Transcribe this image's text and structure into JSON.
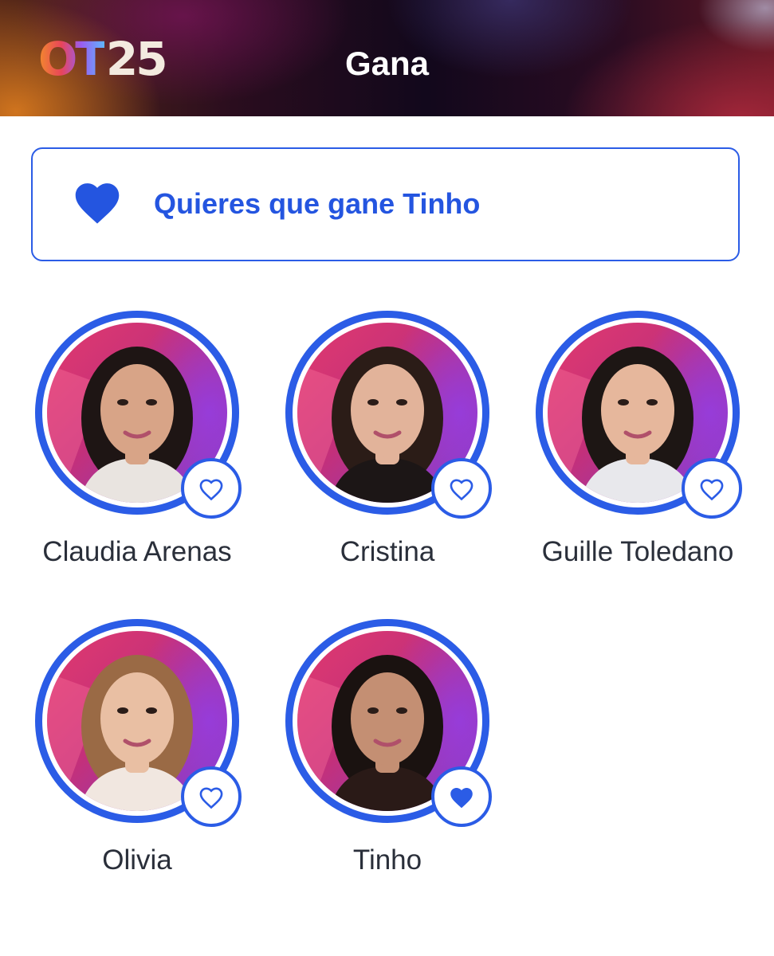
{
  "header": {
    "logo_text_ot": "OT",
    "logo_text_num": "25",
    "title": "Gana"
  },
  "vote_banner": {
    "text": "Quieres que gane Tinho",
    "icon": "heart-filled-icon"
  },
  "contestants": [
    {
      "name": "Claudia Arenas",
      "liked": false,
      "icon": "heart-outline-icon",
      "hair": "#1e1514",
      "skin": "#d8a487",
      "shirt": "#e9e4e0"
    },
    {
      "name": "Cristina",
      "liked": false,
      "icon": "heart-outline-icon",
      "hair": "#2b1c17",
      "skin": "#e2b39a",
      "shirt": "#1c1616"
    },
    {
      "name": "Guille Toledano",
      "liked": false,
      "icon": "heart-outline-icon",
      "hair": "#1d1614",
      "skin": "#e6b79c",
      "shirt": "#e8e8ec"
    },
    {
      "name": "Olivia",
      "liked": false,
      "icon": "heart-outline-icon",
      "hair": "#9a6a45",
      "skin": "#e9bfa3",
      "shirt": "#f1e7e0"
    },
    {
      "name": "Tinho",
      "liked": true,
      "icon": "heart-filled-icon",
      "hair": "#1a1210",
      "skin": "#c48f73",
      "shirt": "#2a1a17"
    }
  ],
  "colors": {
    "accent": "#2b5ce6",
    "accent_text": "#2455e0",
    "name_text": "#2a2f3a"
  }
}
